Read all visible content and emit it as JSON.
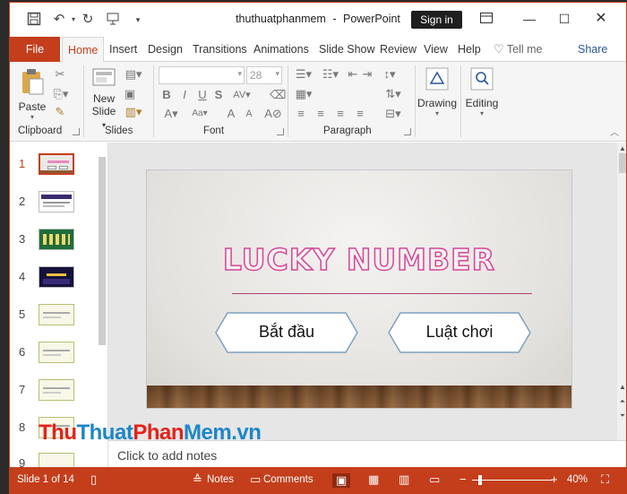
{
  "window": {
    "doc_title": "thuthuatphanmem",
    "separator": "-",
    "app_name": "PowerPoint",
    "sign_in": "Sign in"
  },
  "tabs": {
    "file": "File",
    "items": [
      "Home",
      "Insert",
      "Design",
      "Transitions",
      "Animations",
      "Slide Show",
      "Review",
      "View",
      "Help"
    ],
    "tell_me": "Tell me",
    "share": "Share"
  },
  "ribbon": {
    "clipboard": {
      "label": "Clipboard",
      "paste": "Paste"
    },
    "slides": {
      "label": "Slides",
      "new_slide_1": "New",
      "new_slide_2": "Slide"
    },
    "font": {
      "label": "Font",
      "size": "28",
      "bold": "B",
      "italic": "I",
      "underline": "U",
      "strike": "S",
      "spacing": "AV",
      "color": "A",
      "grow": "A",
      "shrink": "A",
      "case": "Aa",
      "clear": "A"
    },
    "paragraph": {
      "label": "Paragraph"
    },
    "drawing": {
      "label": "Drawing"
    },
    "editing": {
      "label": "Editing"
    }
  },
  "thumbnails": [
    "1",
    "2",
    "3",
    "4",
    "5",
    "6",
    "7",
    "8",
    "9"
  ],
  "slide": {
    "title": "LUCKY NUMBER",
    "button_start": "Bắt đầu",
    "button_rules": "Luật chơi"
  },
  "notes": {
    "placeholder": "Click to add notes"
  },
  "watermark": {
    "part1": "Thu",
    "part2": "Thuat",
    "part3": "Phan",
    "part4": "Mem",
    "part5": ".vn"
  },
  "status": {
    "slide_info": "Slide 1 of 14",
    "notes": "Notes",
    "comments": "Comments",
    "zoom": "40%"
  },
  "colors": {
    "accent": "#c43e1c",
    "title_stroke": "#d6479a"
  }
}
